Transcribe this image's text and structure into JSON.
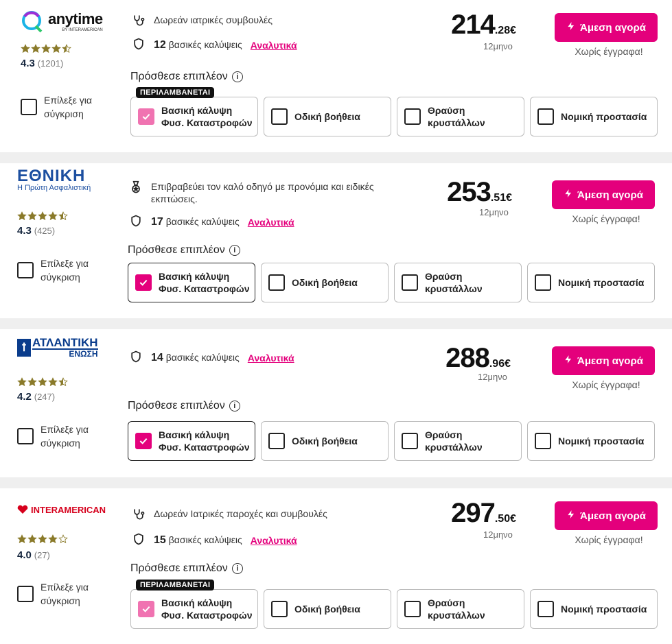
{
  "labels": {
    "compare": "Επίλεξε για σύγκριση",
    "details": "Αναλυτικά",
    "add_more": "Πρόσθεσε επιπλέον",
    "info": "i",
    "buy": "Άμεση αγορά",
    "no_docs": "Χωρίς έγγραφα!",
    "included": "ΠΕΡΙΛΑΜΒΑΝΕΤΑΙ",
    "period": "12μηνο",
    "currency": "€"
  },
  "options": [
    "Βασική κάλυψη Φυσ. Καταστροφών",
    "Οδική βοήθεια",
    "Θραύση κρυστάλλων",
    "Νομική προστασία"
  ],
  "offers": [
    {
      "logo": "anytime",
      "logo_sub": "BY INTERAMERICAN",
      "stars": 4.5,
      "rating": "4.3",
      "reviews": "(1201)",
      "perk": "Δωρεάν ιατρικές συμβουλές",
      "perk_icon": "stethoscope-icon",
      "coverages_count": "12",
      "coverages_label": "βασικές καλύψεις",
      "price_int": "214",
      "price_dec": ".28€",
      "included_badge": true
    },
    {
      "logo": "ΕΘΝΙΚΗ",
      "logo_sub": "Η Πρώτη Ασφαλιστική",
      "stars": 4.5,
      "rating": "4.3",
      "reviews": "(425)",
      "perk": "Επιβραβεύει τον καλό οδηγό με προνόμια και ειδικές εκπτώσεις.",
      "perk_icon": "medal-icon",
      "coverages_count": "17",
      "coverages_label": "βασικές καλύψεις",
      "price_int": "253",
      "price_dec": ".51€",
      "included_badge": false
    },
    {
      "logo": "ΑΤΛΑΝΤΙΚΗ",
      "logo_sub": "ΕΝΩΣΗ",
      "stars": 4.5,
      "rating": "4.2",
      "reviews": "(247)",
      "perk": "",
      "coverages_count": "14",
      "coverages_label": "βασικές καλύψεις",
      "price_int": "288",
      "price_dec": ".96€",
      "included_badge": false
    },
    {
      "logo": "INTERAMERICAN",
      "stars": 4,
      "rating": "4.0",
      "reviews": "(27)",
      "perk": "Δωρεάν Ιατρικές παροχές και συμβουλές",
      "perk_icon": "stethoscope-icon",
      "coverages_count": "15",
      "coverages_label": "βασικές καλύψεις",
      "price_int": "297",
      "price_dec": ".50€",
      "included_badge": true
    }
  ],
  "colors": {
    "accent": "#e4007c",
    "star": "#8a7a2a"
  }
}
